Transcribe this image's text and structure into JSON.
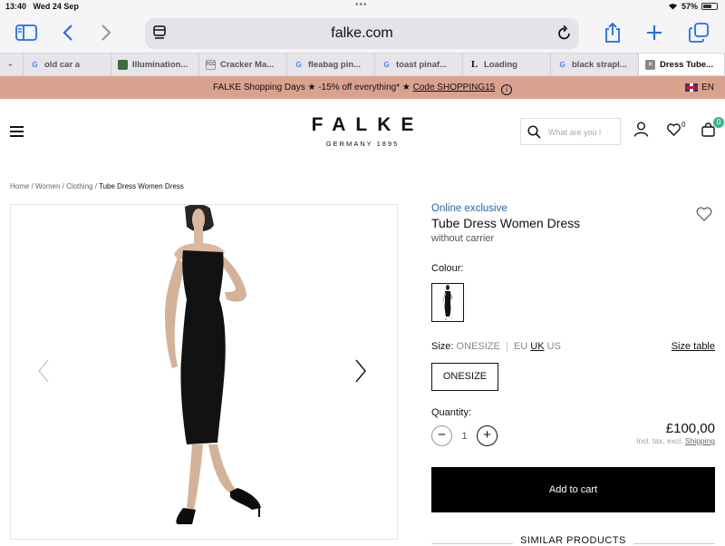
{
  "status_bar": {
    "time": "13:40",
    "date": "Wed 24 Sep",
    "battery": "57%",
    "battery_level": 0.57
  },
  "browser": {
    "url": "falke.com",
    "tabs": [
      {
        "label": "",
        "favicon": "bird-favicon"
      },
      {
        "label": "old car a",
        "favicon": "google-g"
      },
      {
        "label": "Illumination...",
        "favicon": "image-favicon"
      },
      {
        "label": "Cracker Ma...",
        "favicon": "tcc-favicon"
      },
      {
        "label": "fleabag pin...",
        "favicon": "google-g"
      },
      {
        "label": "toast pinaf...",
        "favicon": "google-g"
      },
      {
        "label": "Loading",
        "favicon": "L-favicon"
      },
      {
        "label": "black strapl...",
        "favicon": "google-g"
      },
      {
        "label": "Dress Tube...",
        "favicon": "close-icon",
        "active": true
      }
    ]
  },
  "promo": {
    "text": "FALKE Shopping Days ★ -15% off everything* ★",
    "code": "Code SHOPPING15",
    "info_glyph": "i",
    "language": "EN"
  },
  "header": {
    "brand": "FALKE",
    "tagline": "GERMANY 1895",
    "search_placeholder": "What are you l",
    "wishlist_count": "0",
    "cart_count": "0"
  },
  "breadcrumb": {
    "items": [
      "Home",
      "Women",
      "Clothing"
    ],
    "separator": " / ",
    "current": "Tube Dress Women Dress"
  },
  "product": {
    "badge": "Online exclusive",
    "title": "Tube Dress Women Dress",
    "subtitle": "without carrier",
    "colour_label": "Colour:",
    "size_label": "Size:",
    "size_value": "ONESIZE",
    "size_systems": [
      "EU",
      "UK",
      "US"
    ],
    "size_system_selected": "UK",
    "size_table_link": "Size table",
    "size_option": "ONESIZE",
    "quantity_label": "Quantity:",
    "quantity": "1",
    "minus_glyph": "−",
    "plus_glyph": "+",
    "price": "£100,00",
    "tax_note": "Incl. tax, excl.",
    "shipping_link": "Shipping",
    "add_to_cart": "Add to cart",
    "similar_products": "SIMILAR PRODUCTS"
  },
  "colors": {
    "promo_bg": "#d9a28f",
    "accent_blue": "#1c6ef2",
    "exclusive_blue": "#2a64a8",
    "cart_badge": "#3fb489",
    "button_black": "#000000"
  }
}
